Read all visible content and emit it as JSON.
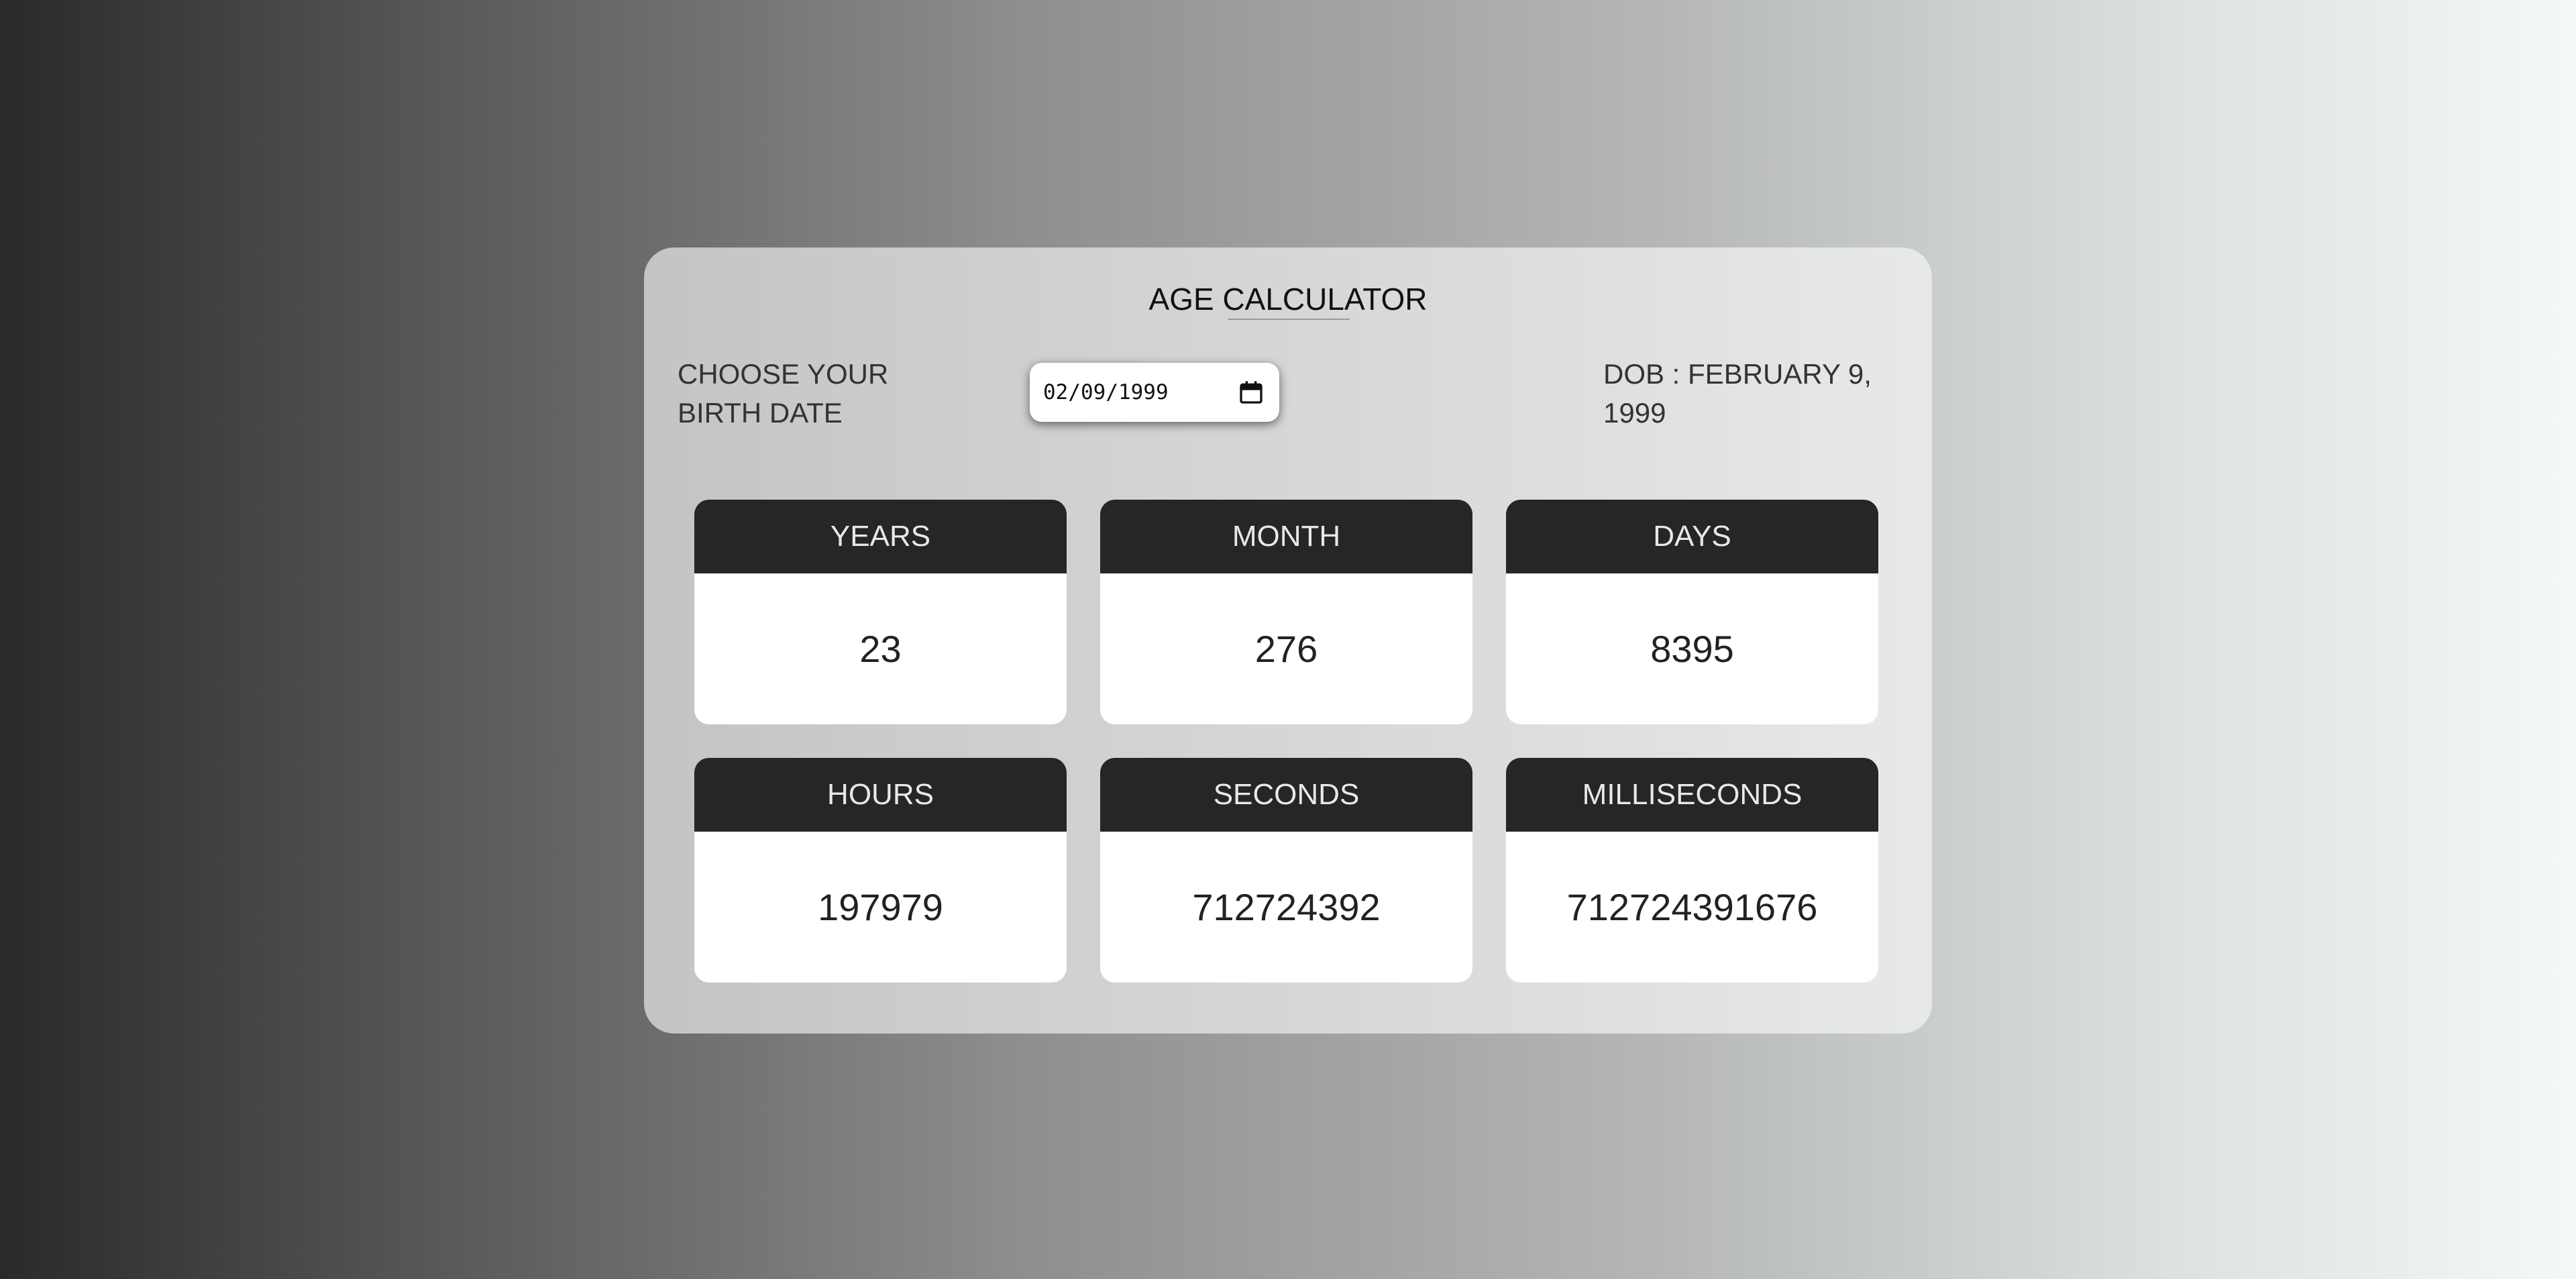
{
  "title": "AGE CALCULATOR",
  "birth": {
    "label": "CHOOSE YOUR BIRTH DATE",
    "input_value": "02/09/1999",
    "dob_text": "DOB : FEBRUARY 9, 1999"
  },
  "stats": [
    {
      "label": "YEARS",
      "value": "23"
    },
    {
      "label": "MONTH",
      "value": "276"
    },
    {
      "label": "DAYS",
      "value": "8395"
    },
    {
      "label": "HOURS",
      "value": "197979"
    },
    {
      "label": "SECONDS",
      "value": "712724392"
    },
    {
      "label": "MILLISECONDS",
      "value": "712724391676"
    }
  ],
  "icons": {
    "calendar": "calendar-icon"
  }
}
